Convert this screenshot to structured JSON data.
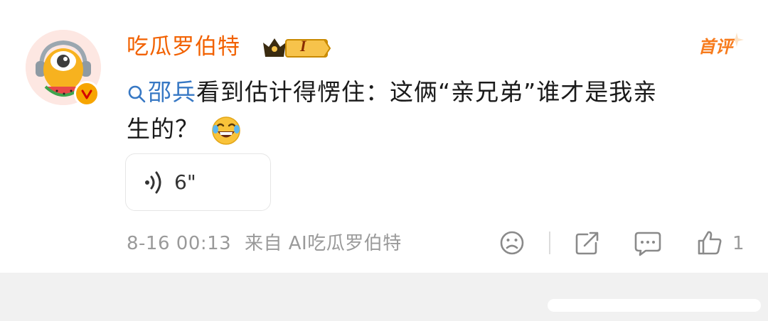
{
  "comment": {
    "username": "吃瓜罗伯特",
    "vip_level": "I",
    "top_label": "首评",
    "mention_name": "邵兵",
    "content_line1": "看到估计得愣住：这俩“亲兄弟”谁才是我亲",
    "content_line2": "生的？",
    "voice_duration": "6\"",
    "date": "8-16 00:13",
    "source": "来自 AI吃瓜罗伯特",
    "like_count": "1"
  },
  "icons": {
    "avatar": "avatar",
    "verified": "verified-badge",
    "mention": "search-icon",
    "emoji": "laugh-tears-emoji",
    "voice": "sound-wave-icon",
    "sad_face": "sad-face-icon",
    "share": "share-icon",
    "comment": "comment-icon",
    "like": "thumbs-up-icon"
  },
  "colors": {
    "username": "#f26100",
    "mention": "#3778c4",
    "meta": "#9a9a9a",
    "vip": "#f7a500"
  }
}
